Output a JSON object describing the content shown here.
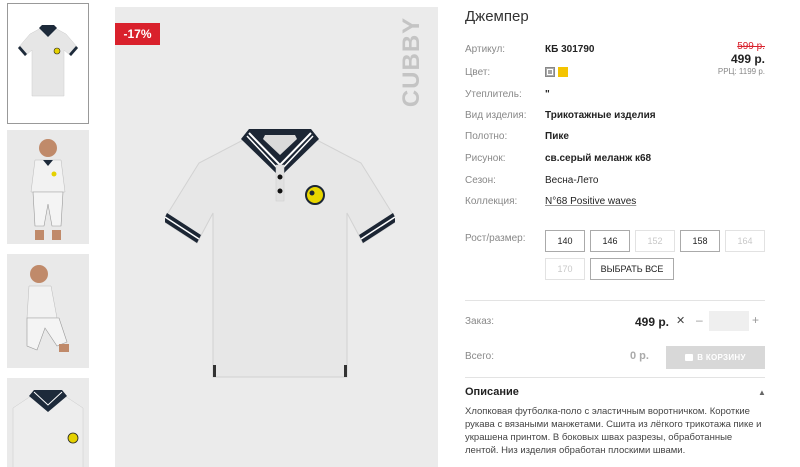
{
  "product": {
    "title": "Джемпер",
    "discount_badge": "-17%",
    "brand": "CUBBY",
    "old_price": "599 р.",
    "price": "499 р.",
    "rrp": "РРЦ: 1199 р."
  },
  "specs": [
    {
      "label": "Артикул:",
      "value": "КБ 301790"
    },
    {
      "label": "Цвет:",
      "value": ""
    },
    {
      "label": "Утеплитель:",
      "value": "\""
    },
    {
      "label": "Вид изделия:",
      "value": "Трикотажные изделия"
    },
    {
      "label": "Полотно:",
      "value": "Пике"
    },
    {
      "label": "Рисунок:",
      "value": "св.серый меланж к68"
    },
    {
      "label": "Сезон:",
      "value": "Весна-Лето"
    },
    {
      "label": "Коллекция:",
      "value": "N°68 Positive waves"
    }
  ],
  "colors": [
    "#a5a5a5",
    "#f4c400"
  ],
  "sizes": {
    "label": "Рост/размер:",
    "options": [
      {
        "value": "140",
        "available": true
      },
      {
        "value": "146",
        "available": true
      },
      {
        "value": "152",
        "available": false
      },
      {
        "value": "158",
        "available": true
      },
      {
        "value": "164",
        "available": false
      },
      {
        "value": "170",
        "available": false
      }
    ],
    "select_all": "ВЫБРАТЬ ВСЕ"
  },
  "order": {
    "label": "Заказ:",
    "price": "499 р.",
    "times": "✕",
    "minus": "–",
    "plus": "+",
    "qty": ""
  },
  "total": {
    "label": "Всего:",
    "value": "0 р.",
    "cart_button": "В КОРЗИНУ"
  },
  "description": {
    "title": "Описание",
    "text": "Хлопковая футболка-поло с эластичным воротничком. Короткие рукава с вязаными манжетами. Сшита из лёгкого трикотажа пике и украшена принтом. В боковых швах разрезы, обработанные лентой. Низ изделия обработан плоскими швами."
  }
}
